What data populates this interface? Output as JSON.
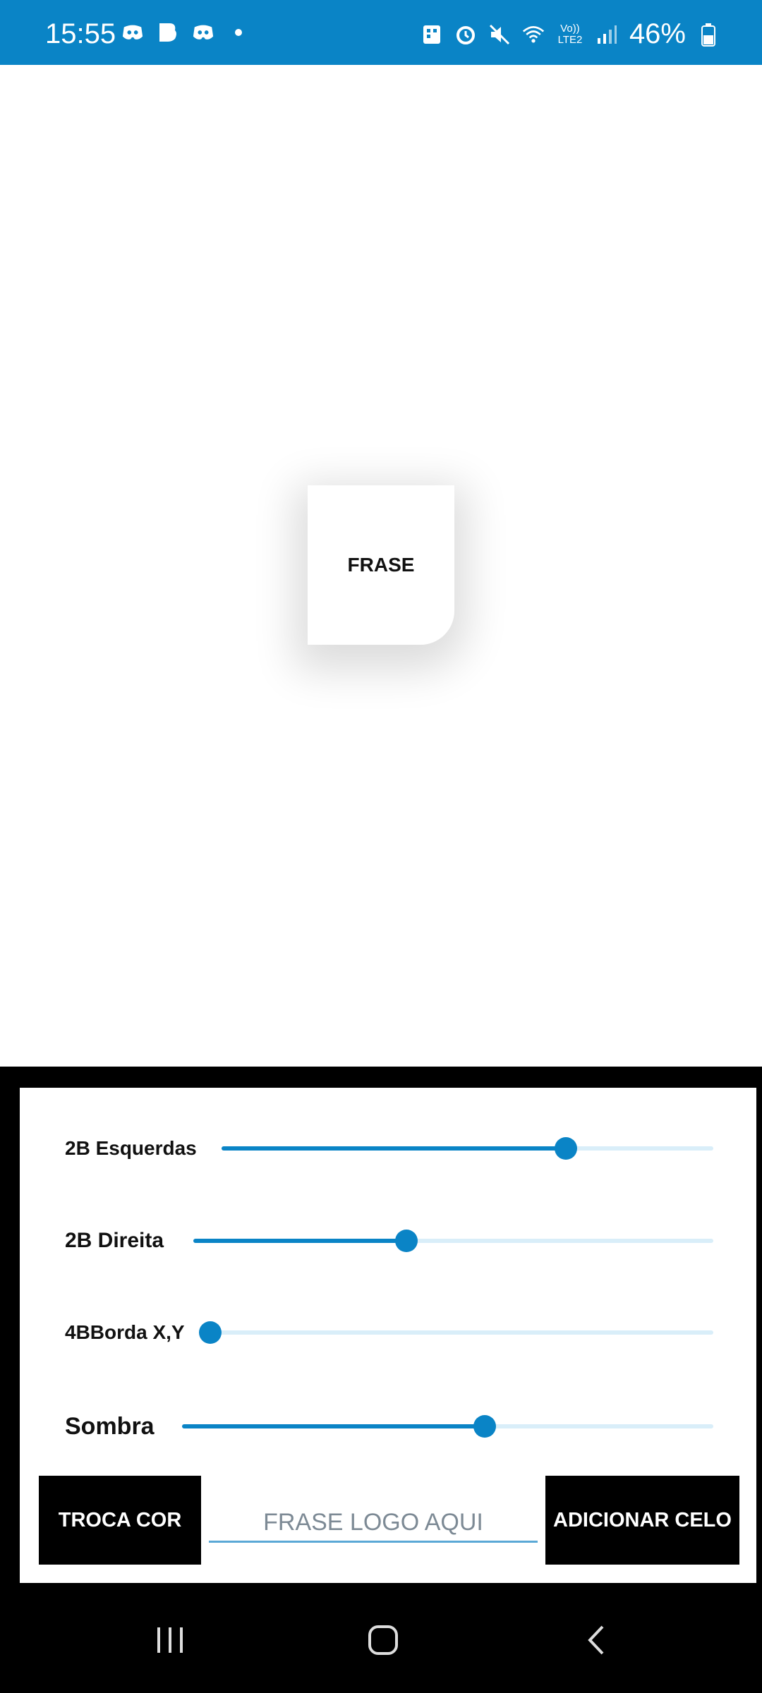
{
  "status_bar": {
    "time": "15:55",
    "battery": "46%",
    "left_icons": [
      "discord-icon",
      "b-app-icon",
      "discord-icon",
      "dot-icon"
    ],
    "right_icons": [
      "building-icon",
      "alarm-icon",
      "mute-icon",
      "wifi-icon",
      "volte-icon",
      "signal-icon",
      "battery-icon"
    ],
    "volte_label": "Vo)) LTE2",
    "color": "#0a84c6"
  },
  "preview": {
    "text": "FRASE"
  },
  "controls": {
    "sliders": [
      {
        "label": "2B Esquerdas",
        "value": 0.7
      },
      {
        "label": "2B Direita",
        "value": 0.41
      },
      {
        "label": "4BBorda X,Y",
        "value": 0.0
      },
      {
        "label": "Sombra",
        "value": 0.57
      }
    ],
    "swap_color_button": "TROCA COR",
    "phrase_input_placeholder": "FRASE LOGO AQUI",
    "add_seal_button": "ADICIONAR CELO",
    "accent": "#0a84c6"
  },
  "nav_bar": {
    "icons": [
      "recent-apps-icon",
      "home-icon",
      "back-icon"
    ]
  }
}
